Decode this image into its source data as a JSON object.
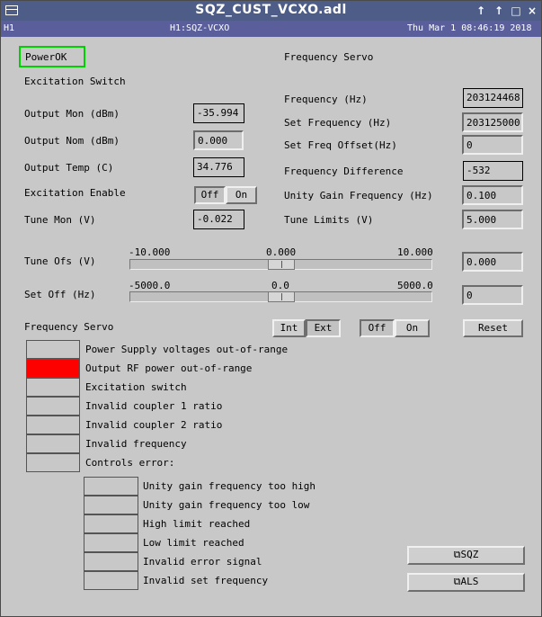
{
  "window": {
    "title": "SQZ_CUST_VCXO.adl",
    "controls": [
      "↑",
      "↑",
      "□",
      "×"
    ]
  },
  "infobar": {
    "ifo": "H1",
    "channel": "H1:SQZ-VCXO",
    "datetime": "Thu Mar  1 08:46:19 2018"
  },
  "power_ok": "PowerOK",
  "left": {
    "excitation_switch": "Excitation Switch",
    "output_mon_label": "Output Mon (dBm)",
    "output_mon_value": "-35.994",
    "output_nom_label": "Output Nom (dBm)",
    "output_nom_value": "0.000",
    "output_temp_label": "Output Temp (C)",
    "output_temp_value": "34.776",
    "exc_enable_label": "Excitation Enable",
    "exc_off": "Off",
    "exc_on": "On",
    "tune_mon_label": "Tune Mon (V)",
    "tune_mon_value": "-0.022"
  },
  "right": {
    "header": "Frequency Servo",
    "freq_label": "Frequency (Hz)",
    "freq_value": "203124468",
    "set_freq_label": "Set Frequency (Hz)",
    "set_freq_value": "203125000",
    "set_freq_offset_label": "Set Freq Offset(Hz)",
    "set_freq_offset_value": "0",
    "freq_diff_label": "Frequency Difference",
    "freq_diff_value": "-532",
    "ugf_label": "Unity Gain Frequency (Hz)",
    "ugf_value": "0.100",
    "tune_limits_label": "Tune Limits (V)",
    "tune_limits_value": "5.000"
  },
  "sliders": {
    "tune_ofs": {
      "label": "Tune Ofs (V)",
      "min": "-10.000",
      "mid": "0.000",
      "max": "10.000",
      "value": "0.000",
      "level": 0.5
    },
    "set_off": {
      "label": "Set Off (Hz)",
      "min": "-5000.0",
      "mid": "0.0",
      "max": "5000.0",
      "value": "0",
      "level": 0.5
    }
  },
  "servo": {
    "label": "Frequency Servo",
    "int": "Int",
    "ext": "Ext",
    "off": "Off",
    "on": "On",
    "reset": "Reset"
  },
  "status_colors": {
    "alarm": "#fd0000",
    "ok": "#c8c8c8",
    "powerok_border": "#00d000"
  },
  "status": [
    {
      "text": "Power Supply voltages out-of-range",
      "alarm": false
    },
    {
      "text": "Output RF power out-of-range",
      "alarm": true
    },
    {
      "text": "Excitation switch",
      "alarm": false
    },
    {
      "text": "Invalid coupler 1 ratio",
      "alarm": false
    },
    {
      "text": "Invalid coupler 2 ratio",
      "alarm": false
    },
    {
      "text": "Invalid frequency",
      "alarm": false
    },
    {
      "text": "Controls error:",
      "alarm": false
    }
  ],
  "sub_status": [
    {
      "text": "Unity gain frequency too high"
    },
    {
      "text": "Unity gain frequency too low"
    },
    {
      "text": "High limit reached"
    },
    {
      "text": "Low limit reached"
    },
    {
      "text": "Invalid error signal"
    },
    {
      "text": "Invalid set frequency"
    }
  ],
  "related": {
    "sqz": "SQZ",
    "als": "ALS",
    "icon": "related-display-icon"
  }
}
